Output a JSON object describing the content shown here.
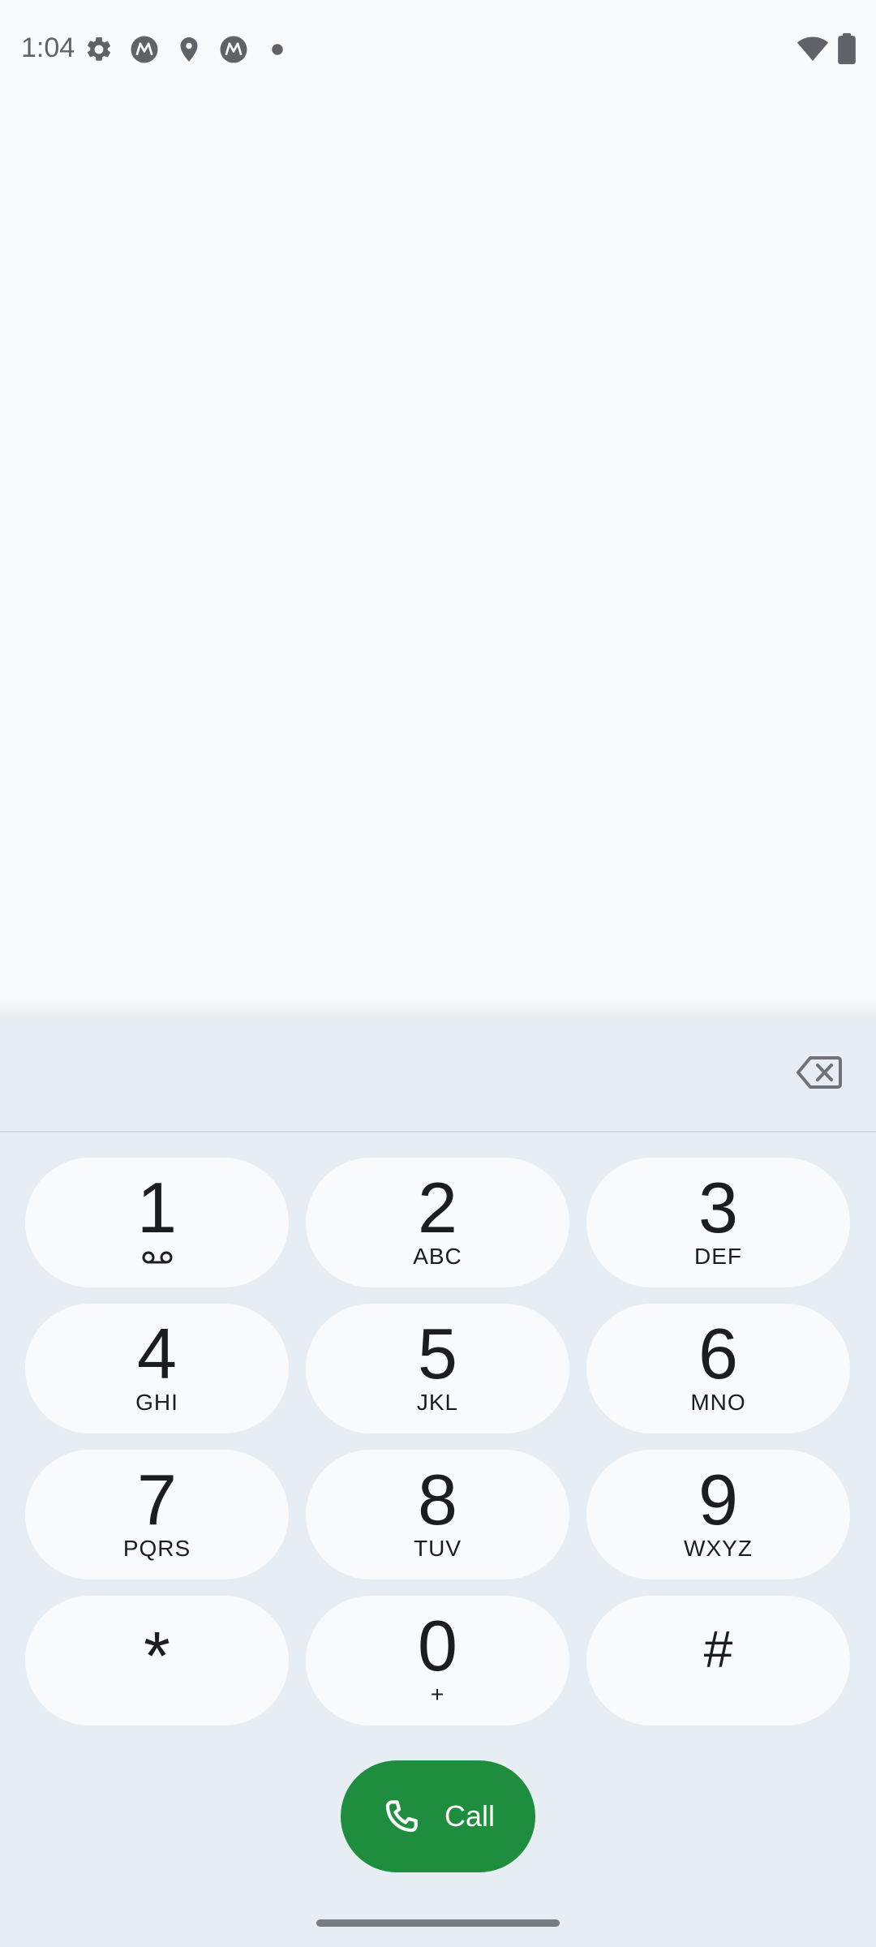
{
  "status_bar": {
    "time": "1:04",
    "left_icons": [
      "gear-icon",
      "motorola-icon",
      "location-icon",
      "motorola-icon",
      "dot-icon"
    ],
    "right_icons": [
      "wifi-icon",
      "battery-icon"
    ]
  },
  "dialer": {
    "number_value": "",
    "keys": [
      {
        "digit": "1",
        "letters": "",
        "extra_icon": "voicemail-icon"
      },
      {
        "digit": "2",
        "letters": "ABC"
      },
      {
        "digit": "3",
        "letters": "DEF"
      },
      {
        "digit": "4",
        "letters": "GHI"
      },
      {
        "digit": "5",
        "letters": "JKL"
      },
      {
        "digit": "6",
        "letters": "MNO"
      },
      {
        "digit": "7",
        "letters": "PQRS"
      },
      {
        "digit": "8",
        "letters": "TUV"
      },
      {
        "digit": "9",
        "letters": "WXYZ"
      },
      {
        "digit": "*",
        "letters": ""
      },
      {
        "digit": "0",
        "letters": "+"
      },
      {
        "digit": "#",
        "letters": ""
      }
    ],
    "call_label": "Call"
  },
  "colors": {
    "background": "#f8fafc",
    "panel": "#e7eef3",
    "key": "#f8fafc",
    "call_button": "#1e8e3e",
    "status_icons": "#5f6368"
  }
}
